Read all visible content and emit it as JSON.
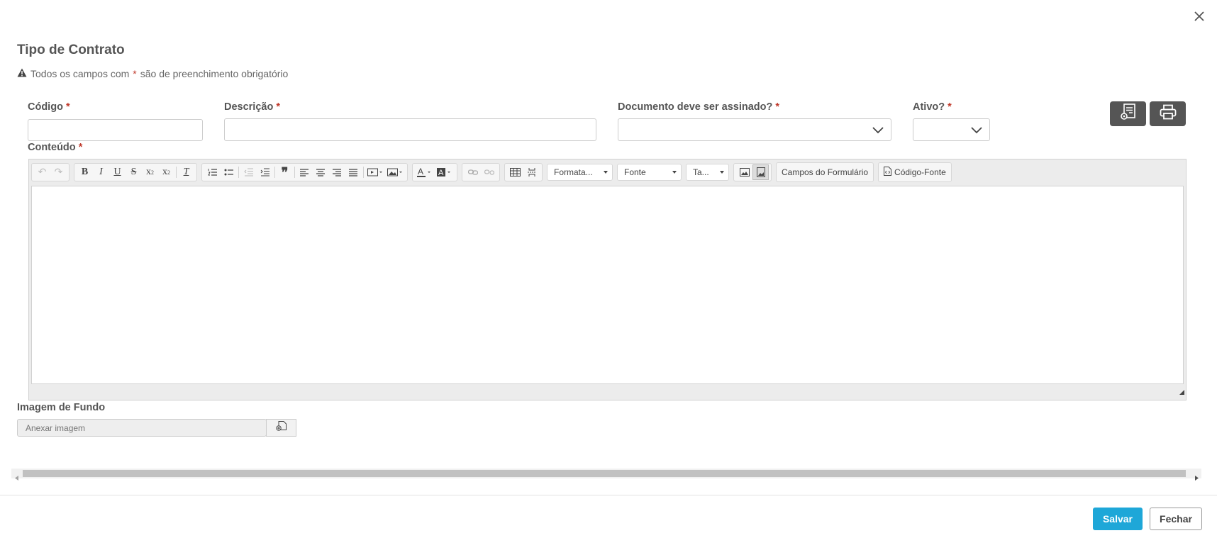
{
  "dialog": {
    "title": "Tipo de Contrato",
    "notice_before": "Todos os campos com",
    "notice_star": "*",
    "notice_after": "são de preenchimento obrigatório"
  },
  "fields": {
    "codigo": {
      "label": "Código",
      "value": ""
    },
    "descricao": {
      "label": "Descrição",
      "value": ""
    },
    "assinado": {
      "label": "Documento deve ser assinado?",
      "value": ""
    },
    "ativo": {
      "label": "Ativo?",
      "value": ""
    },
    "conteudo": {
      "label": "Conteúdo"
    },
    "imagem_fundo": {
      "label": "Imagem de Fundo",
      "placeholder": "Anexar imagem"
    },
    "required_mark": "*"
  },
  "editor_toolbar": {
    "format_combo": "Formata...",
    "font_combo": "Fonte",
    "size_combo": "Ta...",
    "form_fields_button": "Campos do Formulário",
    "source_button": "Código-Fonte"
  },
  "footer": {
    "save_label": "Salvar",
    "close_label": "Fechar"
  },
  "colors": {
    "primary": "#1ea7d8",
    "required": "#c0392b",
    "tool_button": "#555555"
  }
}
